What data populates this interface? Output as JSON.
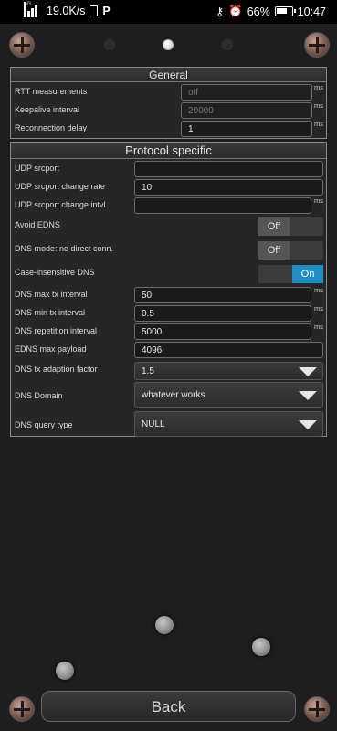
{
  "statusbar": {
    "network_tag": "4G",
    "speed": "19.0K/s",
    "app_badge": "P",
    "battery": "66%",
    "time": "10:47",
    "icons": [
      "signal-icon",
      "sim-icon",
      "key-icon",
      "alarm-icon",
      "battery-icon"
    ]
  },
  "general": {
    "title": "General",
    "rtt": {
      "label": "RTT measurements",
      "value": "off",
      "unit": "ms"
    },
    "keepalive": {
      "label": "Keepalive interval",
      "value": "20000",
      "unit": "ms"
    },
    "reconnect": {
      "label": "Reconnection delay",
      "value": "1",
      "unit": "ms"
    }
  },
  "protocol": {
    "title": "Protocol specific",
    "udp_srcport": {
      "label": "UDP srcport",
      "value": ""
    },
    "udp_change_rate": {
      "label": "UDP srcport change rate",
      "value": "10"
    },
    "udp_change_intvl": {
      "label": "UDP srcport change intvl",
      "value": "",
      "unit": "ms"
    },
    "avoid_edns": {
      "label": "Avoid EDNS",
      "state": "Off"
    },
    "no_direct": {
      "label": "DNS mode: no direct conn.",
      "state": "Off"
    },
    "case_insensitive": {
      "label": "Case-insensitive DNS",
      "state": "On"
    },
    "dns_max_tx": {
      "label": "DNS max tx interval",
      "value": "50",
      "unit": "ms"
    },
    "dns_min_tx": {
      "label": "DNS min tx interval",
      "value": "0.5",
      "unit": "ms"
    },
    "dns_rep": {
      "label": "DNS repetition interval",
      "value": "5000",
      "unit": "ms"
    },
    "edns_payload": {
      "label": "EDNS max payload",
      "value": "4096"
    },
    "dns_adapt": {
      "label": "DNS tx adaption factor",
      "value": "1.5"
    },
    "dns_domain": {
      "label": "DNS Domain",
      "value": "whatever works"
    },
    "dns_query": {
      "label": "DNS query type",
      "value": "NULL"
    }
  },
  "footer": {
    "back_label": "Back"
  },
  "colors": {
    "accent_on": "#1e8fc6",
    "background": "#1e1e1e"
  }
}
